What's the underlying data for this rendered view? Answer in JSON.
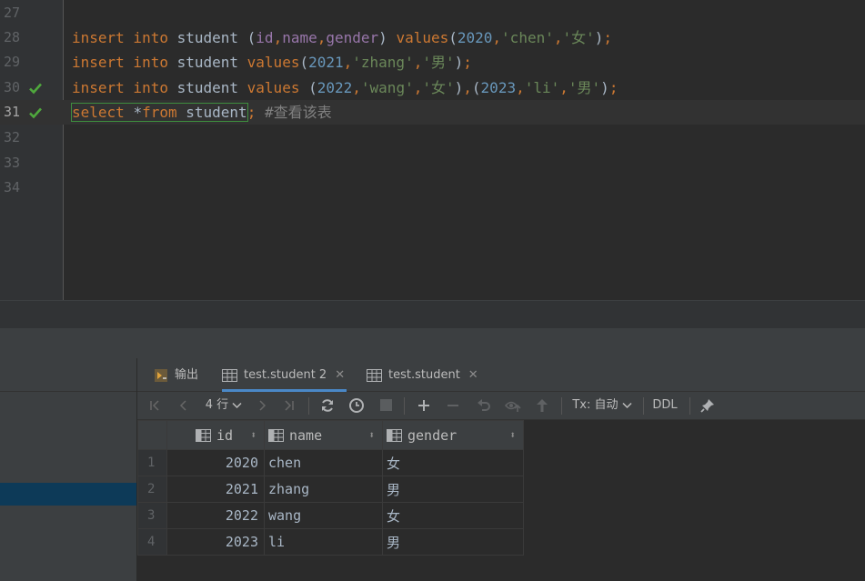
{
  "editor": {
    "lines": [
      {
        "num": "27",
        "code": ""
      },
      {
        "num": "28",
        "code": "insert into student (id,name,gender) values(2020,'chen','女');"
      },
      {
        "num": "29",
        "code": "insert into student values(2021,'zhang','男');"
      },
      {
        "num": "30",
        "code": "insert into student values (2022,'wang','女'),(2023,'li','男');"
      },
      {
        "num": "31",
        "code": "select *from student; #查看该表"
      },
      {
        "num": "32",
        "code": ""
      },
      {
        "num": "33",
        "code": ""
      },
      {
        "num": "34",
        "code": ""
      }
    ],
    "checked_lines": [
      "30",
      "31"
    ],
    "current_line": "31"
  },
  "tabs": [
    {
      "label": "输出",
      "icon": "output-icon",
      "active": false
    },
    {
      "label": "test.student 2",
      "icon": "table-icon",
      "active": true,
      "closable": true
    },
    {
      "label": "test.student",
      "icon": "table-icon",
      "active": false,
      "closable": true
    }
  ],
  "toolbar": {
    "rows_label": "4 行",
    "tx_label": "Tx: 自动",
    "ddl_label": "DDL"
  },
  "grid": {
    "columns": [
      "id",
      "name",
      "gender"
    ],
    "rows": [
      {
        "n": "1",
        "id": "2020",
        "name": "chen",
        "gender": "女"
      },
      {
        "n": "2",
        "id": "2021",
        "name": "zhang",
        "gender": "男"
      },
      {
        "n": "3",
        "id": "2022",
        "name": "wang",
        "gender": "女"
      },
      {
        "n": "4",
        "id": "2023",
        "name": "li",
        "gender": "男"
      }
    ]
  },
  "colors": {
    "keyword": "#cc7832",
    "string": "#6a8759",
    "number": "#6897bb",
    "column": "#9876aa",
    "comment": "#808080",
    "check": "#4fa83d",
    "accent": "#4a88c7"
  }
}
